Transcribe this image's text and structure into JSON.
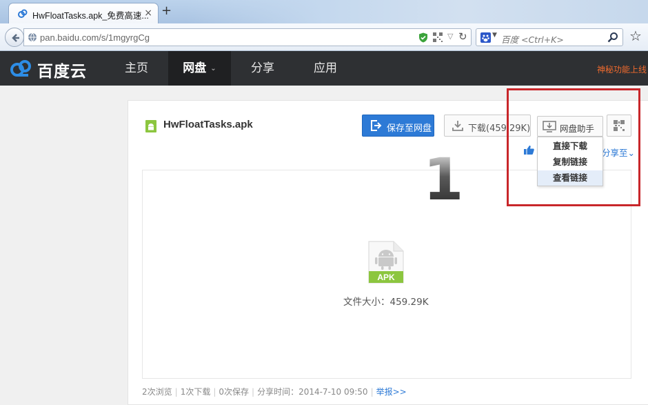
{
  "browser": {
    "tab_title": "HwFloatTasks.apk_免费高速...",
    "tab_close": "×",
    "new_tab": "+",
    "url": "pan.baidu.com/s/1mgyrgCg",
    "search_placeholder": "百度 <Ctrl+K>",
    "reload_glyph": "↻",
    "dropdown_glyph": "▽",
    "star_glyph": "☆"
  },
  "site": {
    "logo_text": "百度云",
    "nav": [
      {
        "label": "主页",
        "active": false
      },
      {
        "label": "网盘",
        "active": true,
        "caret": "⌄"
      },
      {
        "label": "分享",
        "active": false
      },
      {
        "label": "应用",
        "active": false
      }
    ],
    "promo": "神秘功能上线"
  },
  "file": {
    "name": "HwFloatTasks.apk",
    "save_label": "保存至网盘",
    "download_label": "下载(459.29K)",
    "helper_label": "网盘助手",
    "share_label": "分享至⌄",
    "type_badge": "APK",
    "size_text": "文件大小：459.29K",
    "step_number": "1"
  },
  "menu": {
    "items": [
      {
        "label": "直接下载",
        "hover": false
      },
      {
        "label": "复制链接",
        "hover": false
      },
      {
        "label": "查看链接",
        "hover": true
      }
    ]
  },
  "stats": {
    "views": "2次浏览",
    "downloads": "1次下载",
    "saves": "0次保存",
    "share_time": "分享时间：2014-7-10 09:50",
    "report": "举报>>"
  },
  "colors": {
    "accent_blue": "#2d7ad6",
    "header_bg": "#2e3033",
    "promo_orange": "#f26b2e",
    "highlight_red": "#c8262a",
    "android_green": "#8cc63f"
  }
}
